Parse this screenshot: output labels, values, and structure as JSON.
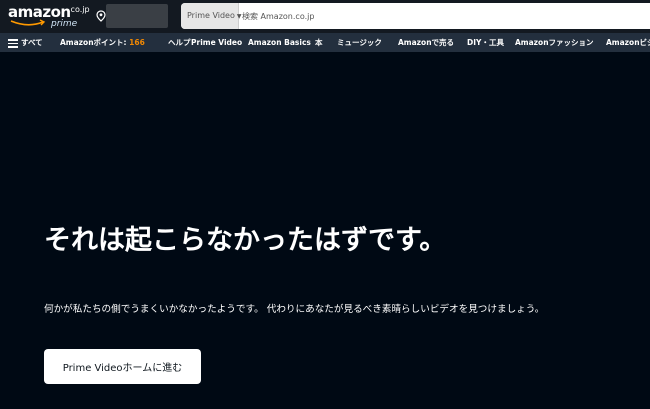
{
  "header": {
    "logo": {
      "main": "amazon",
      "tld": ".co.jp",
      "sub": "prime"
    },
    "location_icon": "location-pin-icon",
    "search": {
      "category": "Prime Video",
      "placeholder": "検索 Amazon.co.jp"
    }
  },
  "nav": {
    "menu_icon": "hamburger-icon",
    "all_label": "すべて",
    "points_label": "Amazonポイント: ",
    "points_value": "166",
    "items": [
      "ヘルプ",
      "Prime Video",
      "Amazon Basics",
      "本",
      "ミュージック",
      "Amazonで売る",
      "DIY・工具",
      "Amazonファッション",
      "Amazonビジ"
    ]
  },
  "main": {
    "headline": "それは起こらなかったはずです。",
    "description": "何かが私たちの側でうまくいかなかったようです。 代わりにあなたが見るべき素晴らしいビデオを見つけましょう。",
    "home_button": "Prime Videoホームに進む"
  },
  "colors": {
    "topbar": "#131921",
    "navbar": "#232f3e",
    "main_bg": "#000914",
    "points_accent": "#f08804"
  }
}
